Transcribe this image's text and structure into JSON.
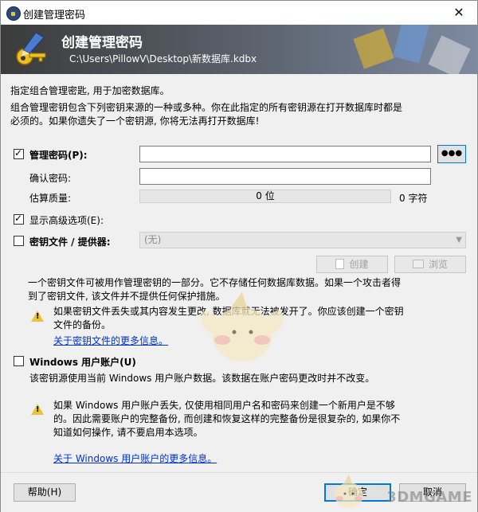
{
  "window": {
    "title": "创建管理密码",
    "close_glyph": "✕"
  },
  "banner": {
    "title": "创建管理密码",
    "path": "C:\\Users\\PillowV\\Desktop\\新数据库.kdbx"
  },
  "intro": {
    "line1": "指定组合管理密匙, 用于加密数据库。",
    "line2": "组合管理密钥包含下列密钥来源的一种或多种。你在此指定的所有密钥源在打开数据库时都是",
    "line3": "必须的。如果你遗失了一个密钥源, 你将无法再打开数据库!"
  },
  "password": {
    "label": "管理密码(P):",
    "checked": true,
    "show_button": "●●●",
    "confirm_label": "确认密码:",
    "quality_label": "估算质量:",
    "quality_value": "0 位",
    "char_count": "0 字符"
  },
  "advanced": {
    "label": "显示高级选项(E):",
    "checked": true
  },
  "keyfile": {
    "label": "密钥文件 / 提供器:",
    "checked": false,
    "dropdown_value": "(无)",
    "create_button": "创建",
    "browse_button": "浏览",
    "desc_line1": "一个密钥文件可被用作管理密钥的一部分。它不存储任何数据库数据。如果一个攻击者得",
    "desc_line2": "到了密钥文件, 该文件并不提供任何保护措施。",
    "warn_line1": "如果密钥文件丢失或其内容发生更改, 数据库就无法被发开了。你应该创建一个密钥",
    "warn_line2": "文件的备份。",
    "more_link": "关于密钥文件的更多信息。"
  },
  "winaccount": {
    "label": "Windows 用户账户(U)",
    "checked": false,
    "desc": "该密钥源使用当前 Windows 用户账户数据。该数据在账户密码更改时并不改变。",
    "warn_line1": "如果 Windows 用户账户丢失, 仅使用相同用户名和密码来创建一个新用户是不够",
    "warn_line2": "的。因此需要账户的完整备份, 而创建和恢复这样的完整备份是很复杂的, 如果你不",
    "warn_line3": "知道如何操作, 请不要启用本选项。",
    "more_link": "关于 Windows 用户账户的更多信息。"
  },
  "footer": {
    "help_button": "帮助(H)",
    "ok_button": "确定",
    "cancel_button": "取消"
  },
  "watermark": "3DMGAME"
}
